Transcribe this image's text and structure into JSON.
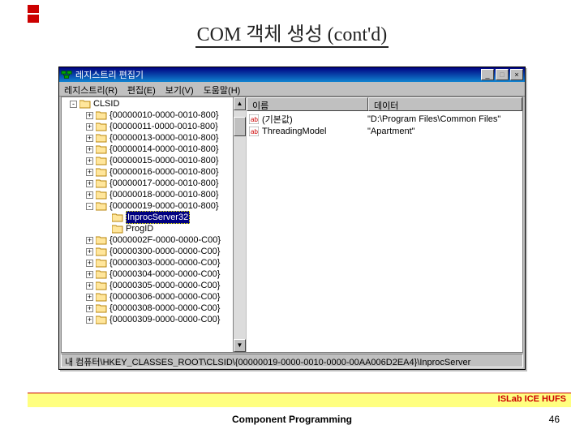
{
  "slide": {
    "title": "COM 객체 생성 (cont'd)",
    "footer_lab": "ISLab ICE HUFS",
    "footer_course": "Component Programming",
    "page": "46"
  },
  "window": {
    "title": "레지스트리 편집기",
    "menu": {
      "registry": "레지스트리(R)",
      "edit": "편집(E)",
      "view": "보기(V)",
      "help": "도움말(H)"
    },
    "status": "내 컴퓨터\\HKEY_CLASSES_ROOT\\CLSID\\{00000019-0000-0010-0000-00AA006D2EA4}\\InprocServer"
  },
  "tree": {
    "root": "CLSID",
    "items": [
      "{00000010-0000-0010-800}",
      "{00000011-0000-0010-800}",
      "{00000013-0000-0010-800}",
      "{00000014-0000-0010-800}",
      "{00000015-0000-0010-800}",
      "{00000016-0000-0010-800}",
      "{00000017-0000-0010-800}",
      "{00000018-0000-0010-800}",
      "{00000019-0000-0010-800}"
    ],
    "selected": "InprocServer32",
    "progid": "ProgID",
    "items2": [
      "{0000002F-0000-0000-C00}",
      "{00000300-0000-0000-C00}",
      "{00000303-0000-0000-C00}",
      "{00000304-0000-0000-C00}",
      "{00000305-0000-0000-C00}",
      "{00000306-0000-0000-C00}",
      "{00000308-0000-0000-C00}",
      "{00000309-0000-0000-C00}"
    ]
  },
  "list": {
    "header_name": "이름",
    "header_data": "데이터",
    "rows": [
      {
        "name": "(기본값)",
        "data": "\"D:\\Program Files\\Common Files\""
      },
      {
        "name": "ThreadingModel",
        "data": "\"Apartment\""
      }
    ]
  }
}
